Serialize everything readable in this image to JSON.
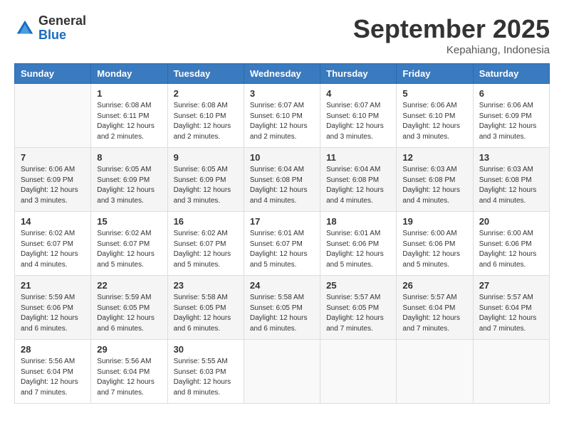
{
  "header": {
    "logo_line1": "General",
    "logo_line2": "Blue",
    "month": "September 2025",
    "location": "Kepahiang, Indonesia"
  },
  "weekdays": [
    "Sunday",
    "Monday",
    "Tuesday",
    "Wednesday",
    "Thursday",
    "Friday",
    "Saturday"
  ],
  "weeks": [
    [
      {
        "num": "",
        "info": ""
      },
      {
        "num": "1",
        "info": "Sunrise: 6:08 AM\nSunset: 6:11 PM\nDaylight: 12 hours\nand 2 minutes."
      },
      {
        "num": "2",
        "info": "Sunrise: 6:08 AM\nSunset: 6:10 PM\nDaylight: 12 hours\nand 2 minutes."
      },
      {
        "num": "3",
        "info": "Sunrise: 6:07 AM\nSunset: 6:10 PM\nDaylight: 12 hours\nand 2 minutes."
      },
      {
        "num": "4",
        "info": "Sunrise: 6:07 AM\nSunset: 6:10 PM\nDaylight: 12 hours\nand 3 minutes."
      },
      {
        "num": "5",
        "info": "Sunrise: 6:06 AM\nSunset: 6:10 PM\nDaylight: 12 hours\nand 3 minutes."
      },
      {
        "num": "6",
        "info": "Sunrise: 6:06 AM\nSunset: 6:09 PM\nDaylight: 12 hours\nand 3 minutes."
      }
    ],
    [
      {
        "num": "7",
        "info": "Sunrise: 6:06 AM\nSunset: 6:09 PM\nDaylight: 12 hours\nand 3 minutes."
      },
      {
        "num": "8",
        "info": "Sunrise: 6:05 AM\nSunset: 6:09 PM\nDaylight: 12 hours\nand 3 minutes."
      },
      {
        "num": "9",
        "info": "Sunrise: 6:05 AM\nSunset: 6:09 PM\nDaylight: 12 hours\nand 3 minutes."
      },
      {
        "num": "10",
        "info": "Sunrise: 6:04 AM\nSunset: 6:08 PM\nDaylight: 12 hours\nand 4 minutes."
      },
      {
        "num": "11",
        "info": "Sunrise: 6:04 AM\nSunset: 6:08 PM\nDaylight: 12 hours\nand 4 minutes."
      },
      {
        "num": "12",
        "info": "Sunrise: 6:03 AM\nSunset: 6:08 PM\nDaylight: 12 hours\nand 4 minutes."
      },
      {
        "num": "13",
        "info": "Sunrise: 6:03 AM\nSunset: 6:08 PM\nDaylight: 12 hours\nand 4 minutes."
      }
    ],
    [
      {
        "num": "14",
        "info": "Sunrise: 6:02 AM\nSunset: 6:07 PM\nDaylight: 12 hours\nand 4 minutes."
      },
      {
        "num": "15",
        "info": "Sunrise: 6:02 AM\nSunset: 6:07 PM\nDaylight: 12 hours\nand 5 minutes."
      },
      {
        "num": "16",
        "info": "Sunrise: 6:02 AM\nSunset: 6:07 PM\nDaylight: 12 hours\nand 5 minutes."
      },
      {
        "num": "17",
        "info": "Sunrise: 6:01 AM\nSunset: 6:07 PM\nDaylight: 12 hours\nand 5 minutes."
      },
      {
        "num": "18",
        "info": "Sunrise: 6:01 AM\nSunset: 6:06 PM\nDaylight: 12 hours\nand 5 minutes."
      },
      {
        "num": "19",
        "info": "Sunrise: 6:00 AM\nSunset: 6:06 PM\nDaylight: 12 hours\nand 5 minutes."
      },
      {
        "num": "20",
        "info": "Sunrise: 6:00 AM\nSunset: 6:06 PM\nDaylight: 12 hours\nand 6 minutes."
      }
    ],
    [
      {
        "num": "21",
        "info": "Sunrise: 5:59 AM\nSunset: 6:06 PM\nDaylight: 12 hours\nand 6 minutes."
      },
      {
        "num": "22",
        "info": "Sunrise: 5:59 AM\nSunset: 6:05 PM\nDaylight: 12 hours\nand 6 minutes."
      },
      {
        "num": "23",
        "info": "Sunrise: 5:58 AM\nSunset: 6:05 PM\nDaylight: 12 hours\nand 6 minutes."
      },
      {
        "num": "24",
        "info": "Sunrise: 5:58 AM\nSunset: 6:05 PM\nDaylight: 12 hours\nand 6 minutes."
      },
      {
        "num": "25",
        "info": "Sunrise: 5:57 AM\nSunset: 6:05 PM\nDaylight: 12 hours\nand 7 minutes."
      },
      {
        "num": "26",
        "info": "Sunrise: 5:57 AM\nSunset: 6:04 PM\nDaylight: 12 hours\nand 7 minutes."
      },
      {
        "num": "27",
        "info": "Sunrise: 5:57 AM\nSunset: 6:04 PM\nDaylight: 12 hours\nand 7 minutes."
      }
    ],
    [
      {
        "num": "28",
        "info": "Sunrise: 5:56 AM\nSunset: 6:04 PM\nDaylight: 12 hours\nand 7 minutes."
      },
      {
        "num": "29",
        "info": "Sunrise: 5:56 AM\nSunset: 6:04 PM\nDaylight: 12 hours\nand 7 minutes."
      },
      {
        "num": "30",
        "info": "Sunrise: 5:55 AM\nSunset: 6:03 PM\nDaylight: 12 hours\nand 8 minutes."
      },
      {
        "num": "",
        "info": ""
      },
      {
        "num": "",
        "info": ""
      },
      {
        "num": "",
        "info": ""
      },
      {
        "num": "",
        "info": ""
      }
    ]
  ]
}
